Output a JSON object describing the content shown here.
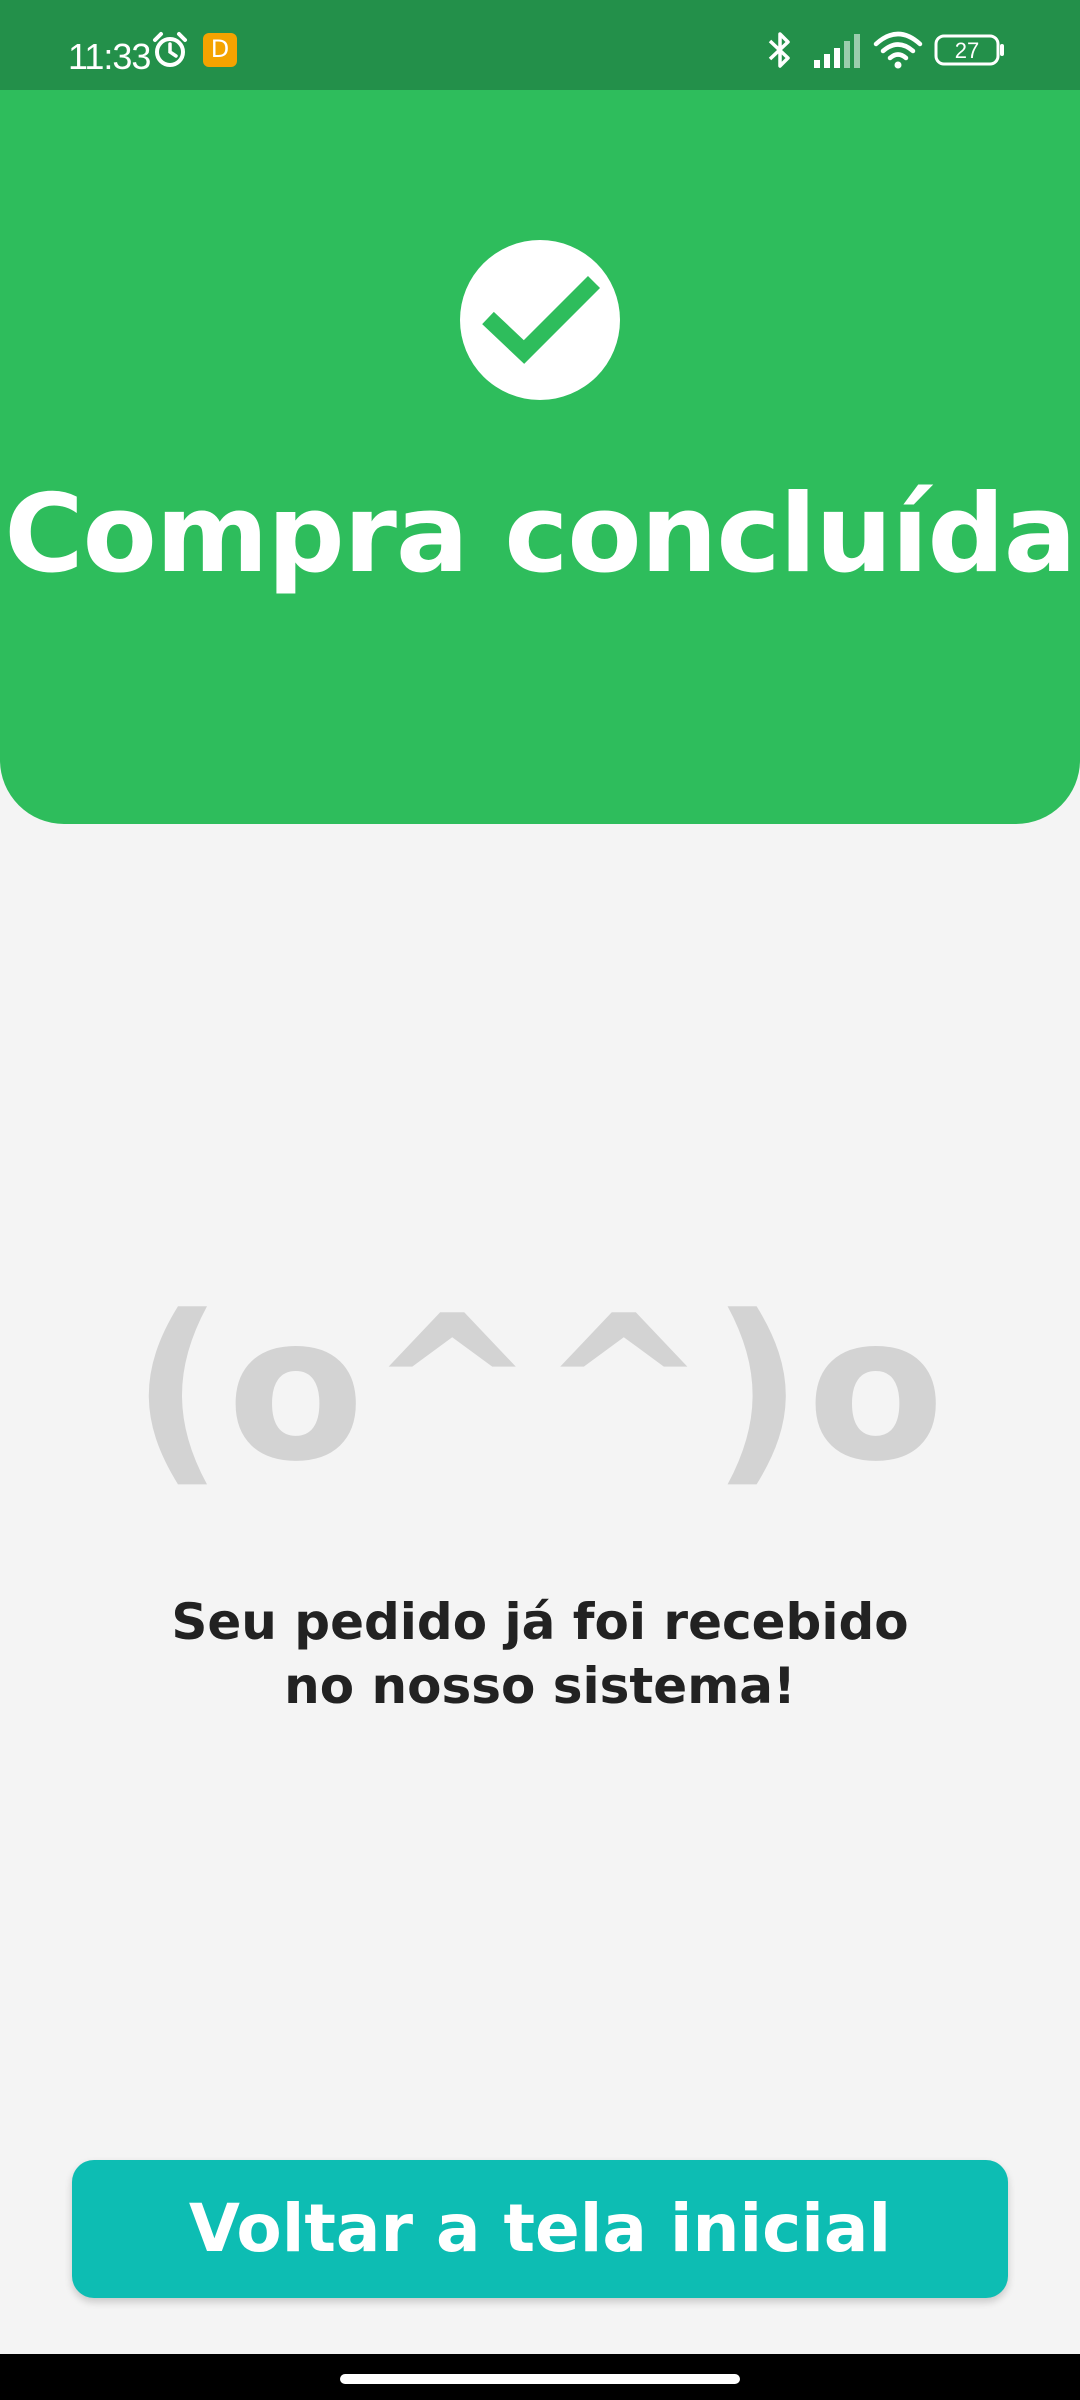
{
  "status_bar": {
    "time": "11:33",
    "battery": "27",
    "icons": [
      "alarm-icon",
      "app-notification-icon",
      "bluetooth-icon",
      "signal-icon",
      "wifi-icon",
      "battery-icon"
    ],
    "notification_badge": "D",
    "background_color": "#23904a"
  },
  "header": {
    "title": "Compra concluída",
    "icon": "check-icon",
    "background_color": "#2ebd5c"
  },
  "main": {
    "emoticon": "(o^^)o",
    "message_line1": "Seu pedido já foi recebido",
    "message_line2": "no nosso sistema!"
  },
  "footer": {
    "home_button_label": "Voltar a tela inicial",
    "button_color": "#0dbdb3"
  }
}
